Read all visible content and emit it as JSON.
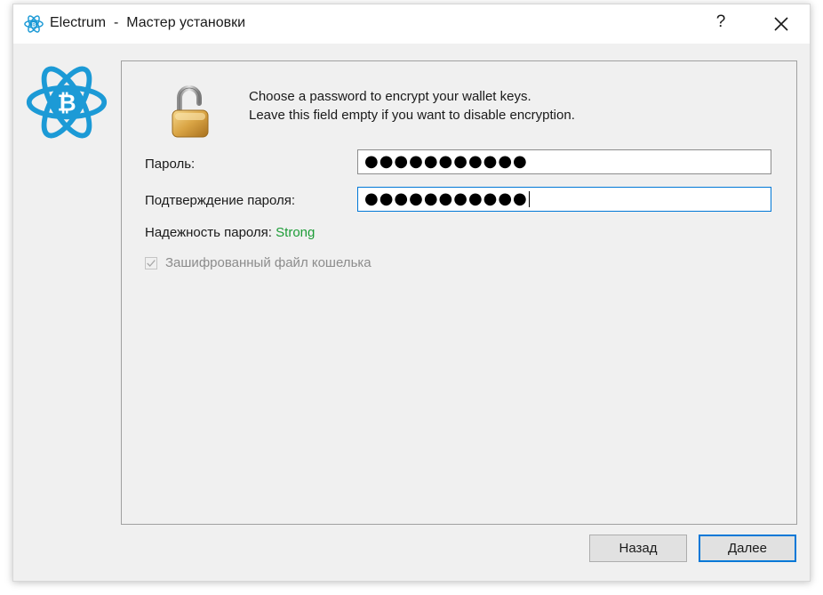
{
  "window": {
    "app_name": "Electrum",
    "separator": "-",
    "title": "Мастер установки",
    "help_label": "?"
  },
  "intro": {
    "line1": "Choose a password to encrypt your wallet keys.",
    "line2": "Leave this field empty if you want to disable encryption."
  },
  "form": {
    "password_label": "Пароль:",
    "password_value": "●●●●●●●●●●●",
    "confirm_label": "Подтверждение пароля:",
    "confirm_value": "●●●●●●●●●●●",
    "strength_label": "Надежность пароля:",
    "strength_value": "Strong",
    "encrypt_checkbox_label": "Зашифрованный файл кошелька",
    "encrypt_checked": true
  },
  "buttons": {
    "back": "Назад",
    "next": "Далее"
  },
  "colors": {
    "accent": "#0078d7",
    "electrum_blue": "#1c9ad6",
    "strength_strong": "#1d9c37",
    "disabled_text": "#8c8c8c"
  },
  "icons": [
    "electrum-logo-icon",
    "close-icon",
    "unlocked-padlock-icon",
    "checkmark-icon"
  ]
}
